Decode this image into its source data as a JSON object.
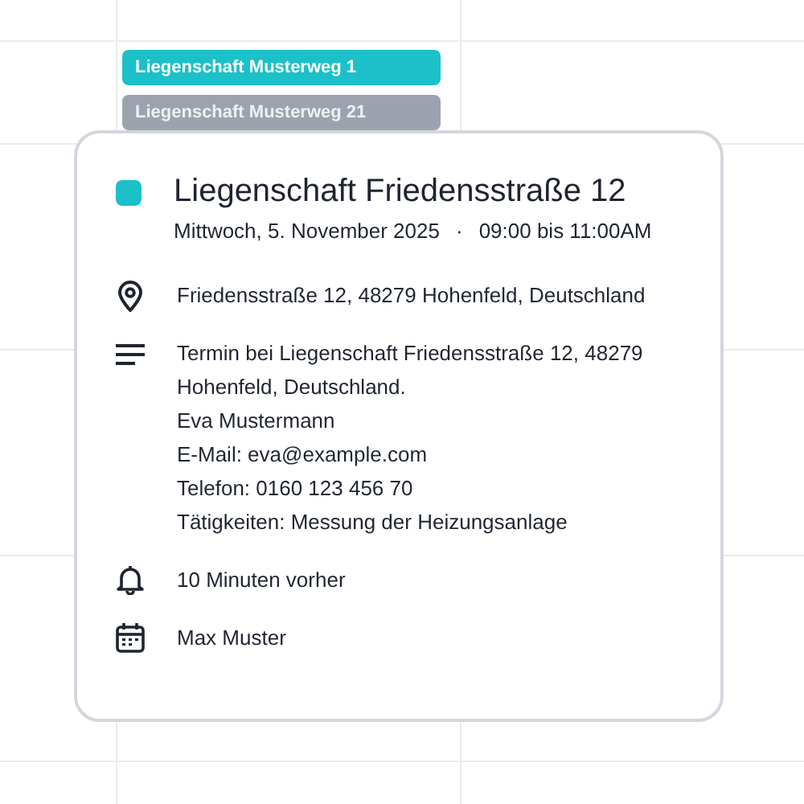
{
  "events": [
    {
      "title": "Liegenschaft Musterweg 1",
      "color": "#1cc0c8"
    },
    {
      "title": "Liegenschaft Musterweg 21",
      "color": "#9ca3af"
    }
  ],
  "popup": {
    "color": "#1cc0c8",
    "title": "Liegenschaft Friedensstraße 12",
    "date": "Mittwoch, 5. November 2025",
    "separator": "·",
    "time": "09:00 bis 11:00AM",
    "details": [
      {
        "kind": "location",
        "lines": [
          "Friedensstraße 12, 48279 Hohenfeld, Deutschland"
        ]
      },
      {
        "kind": "description",
        "lines": [
          "Termin bei Liegenschaft Friedensstraße 12, 48279 Hohenfeld, Deutschland.",
          "Eva Mustermann",
          "E-Mail: eva@example.com",
          "Telefon: 0160 123 456 70",
          "Tätigkeiten: Messung der Heizungsanlage"
        ]
      },
      {
        "kind": "reminder",
        "lines": [
          "10 Minuten vorher"
        ]
      },
      {
        "kind": "calendar",
        "lines": [
          "Max Muster"
        ]
      }
    ]
  }
}
